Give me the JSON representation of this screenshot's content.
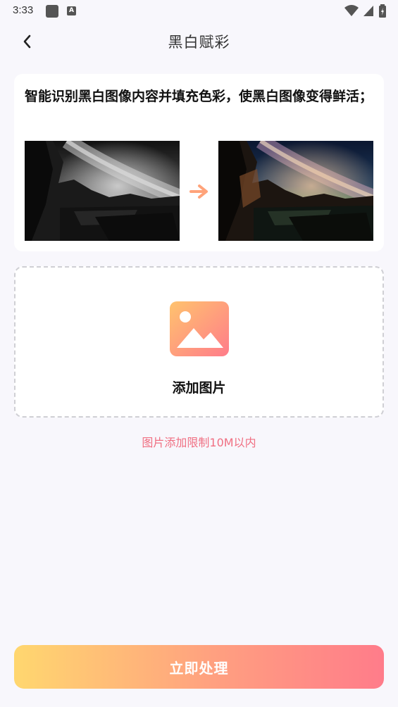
{
  "status_bar": {
    "time": "3:33",
    "icons": [
      "notification-square-icon",
      "a-badge-icon",
      "wifi-icon",
      "cellular-signal-icon",
      "battery-icon"
    ]
  },
  "header": {
    "title": "黑白赋彩",
    "back_icon": "chevron-left-icon"
  },
  "intro": {
    "description": "智能识别黑白图像内容并填充色彩，使黑白图像变得鲜活；",
    "before_image": "black-and-white milky way over rocky lake",
    "after_image": "colorized milky way over rocky lake",
    "arrow_icon": "arrow-right-icon",
    "arrow_color": "#ffa37a"
  },
  "upload": {
    "icon": "image-placeholder-icon",
    "label": "添加图片"
  },
  "limit_note": "图片添加限制10M以内",
  "action": {
    "label": "立即处理",
    "gradient_start": "#ffd76f",
    "gradient_end": "#ff7c8a"
  },
  "colors": {
    "background": "#f8f7fc",
    "accent_text": "#f06f82"
  }
}
